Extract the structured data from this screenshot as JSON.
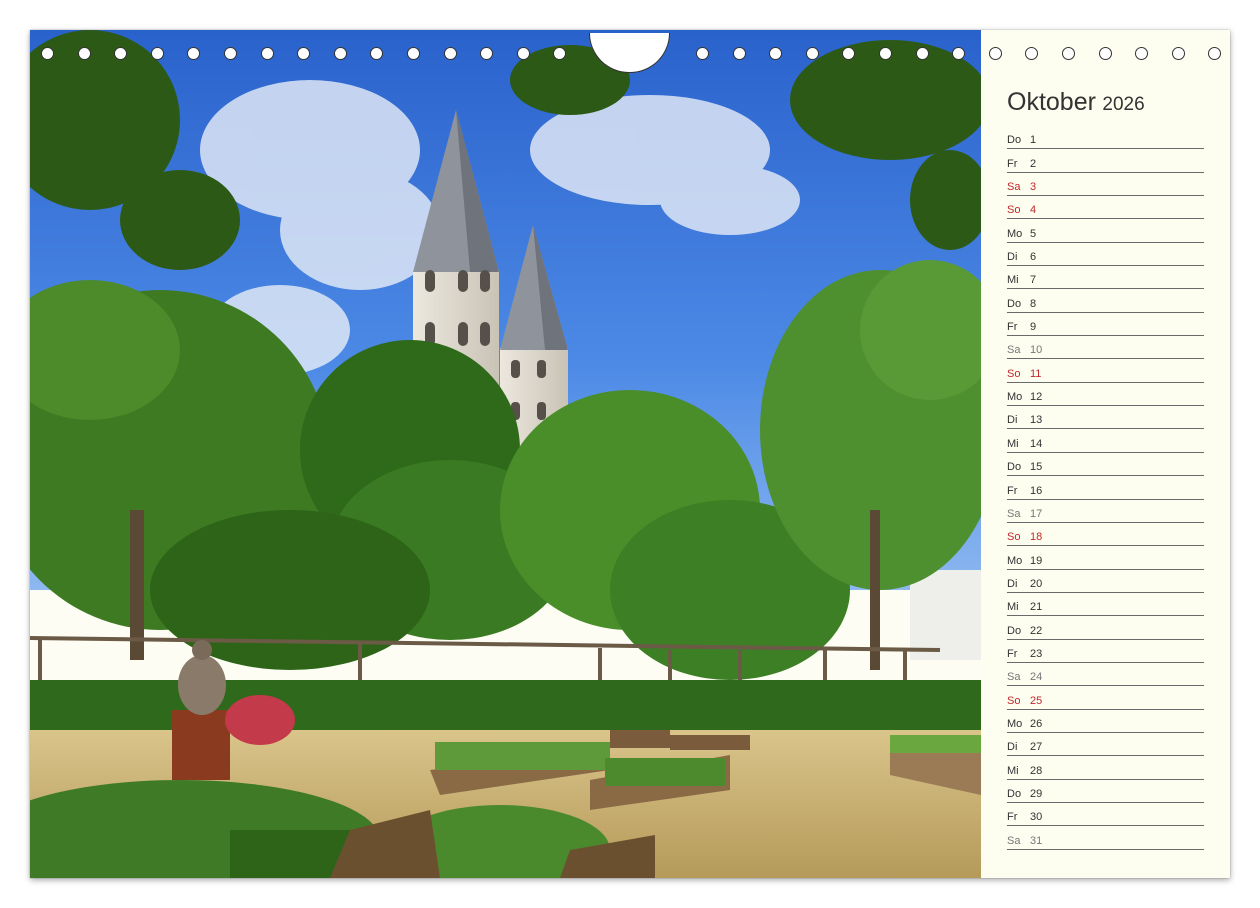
{
  "calendar": {
    "month": "Oktober",
    "year": "2026",
    "days": [
      {
        "wd": "Do",
        "d": "1",
        "kind": ""
      },
      {
        "wd": "Fr",
        "d": "2",
        "kind": ""
      },
      {
        "wd": "Sa",
        "d": "3",
        "kind": "sat red"
      },
      {
        "wd": "So",
        "d": "4",
        "kind": "sun"
      },
      {
        "wd": "Mo",
        "d": "5",
        "kind": ""
      },
      {
        "wd": "Di",
        "d": "6",
        "kind": ""
      },
      {
        "wd": "Mi",
        "d": "7",
        "kind": ""
      },
      {
        "wd": "Do",
        "d": "8",
        "kind": ""
      },
      {
        "wd": "Fr",
        "d": "9",
        "kind": ""
      },
      {
        "wd": "Sa",
        "d": "10",
        "kind": "sat"
      },
      {
        "wd": "So",
        "d": "11",
        "kind": "sun"
      },
      {
        "wd": "Mo",
        "d": "12",
        "kind": ""
      },
      {
        "wd": "Di",
        "d": "13",
        "kind": ""
      },
      {
        "wd": "Mi",
        "d": "14",
        "kind": ""
      },
      {
        "wd": "Do",
        "d": "15",
        "kind": ""
      },
      {
        "wd": "Fr",
        "d": "16",
        "kind": ""
      },
      {
        "wd": "Sa",
        "d": "17",
        "kind": "sat"
      },
      {
        "wd": "So",
        "d": "18",
        "kind": "sun"
      },
      {
        "wd": "Mo",
        "d": "19",
        "kind": ""
      },
      {
        "wd": "Di",
        "d": "20",
        "kind": ""
      },
      {
        "wd": "Mi",
        "d": "21",
        "kind": ""
      },
      {
        "wd": "Do",
        "d": "22",
        "kind": ""
      },
      {
        "wd": "Fr",
        "d": "23",
        "kind": ""
      },
      {
        "wd": "Sa",
        "d": "24",
        "kind": "sat"
      },
      {
        "wd": "So",
        "d": "25",
        "kind": "sun"
      },
      {
        "wd": "Mo",
        "d": "26",
        "kind": ""
      },
      {
        "wd": "Di",
        "d": "27",
        "kind": ""
      },
      {
        "wd": "Mi",
        "d": "28",
        "kind": ""
      },
      {
        "wd": "Do",
        "d": "29",
        "kind": ""
      },
      {
        "wd": "Fr",
        "d": "30",
        "kind": ""
      },
      {
        "wd": "Sa",
        "d": "31",
        "kind": "sat"
      }
    ]
  },
  "photo": {
    "subject": "church-towers-garden-image"
  },
  "colors": {
    "sky": "#2f6fd6",
    "foliage": "#3f7f1f",
    "paper": "#fdfdf0",
    "holiday_red": "#c0282b"
  }
}
